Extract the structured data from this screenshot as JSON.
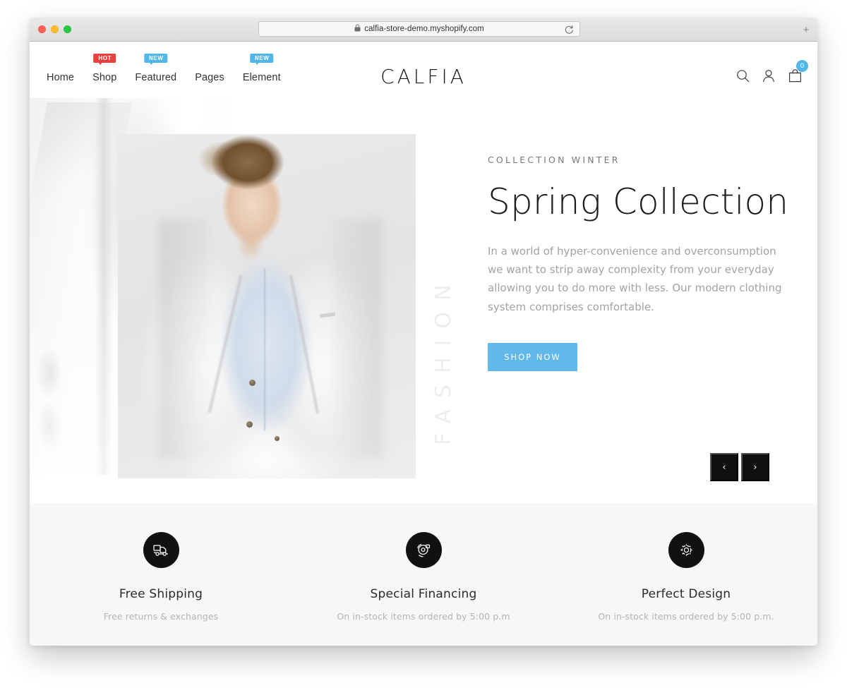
{
  "browser": {
    "url": "calfia-store-demo.myshopify.com",
    "lock_icon": "lock-icon",
    "reload_icon": "reload-icon",
    "new_tab_label": "+",
    "traffic_lights": [
      "close",
      "minimize",
      "zoom"
    ]
  },
  "header": {
    "logo": "CALFIA",
    "nav": [
      {
        "label": "Home",
        "badge": null,
        "badge_type": null
      },
      {
        "label": "Shop",
        "badge": "HOT",
        "badge_type": "hot"
      },
      {
        "label": "Featured",
        "badge": "NEW",
        "badge_type": "new"
      },
      {
        "label": "Pages",
        "badge": null,
        "badge_type": null
      },
      {
        "label": "Element",
        "badge": "NEW",
        "badge_type": "new"
      }
    ],
    "actions": {
      "search_icon": "search-icon",
      "account_icon": "user-icon",
      "cart_icon": "shopping-bag-icon",
      "cart_count": "0"
    }
  },
  "hero": {
    "vertical_word": "FASHION",
    "eyebrow": "COLLECTION WINTER",
    "title": "Spring Collection",
    "paragraph": "In a world of hyper-convenience and overconsumption we want to strip away complexity from your everyday allowing you to do more with less. Our modern clothing system comprises comfortable.",
    "cta_label": "SHOP NOW",
    "prev_label": "‹",
    "next_label": "›"
  },
  "features": [
    {
      "icon": "delivery-truck-icon",
      "title": "Free Shipping",
      "subtitle": "Free returns & exchanges"
    },
    {
      "icon": "financing-icon",
      "title": "Special Financing",
      "subtitle": "On in-stock items ordered by 5:00 p.m"
    },
    {
      "icon": "gear-design-icon",
      "title": "Perfect Design",
      "subtitle": "On in-stock items ordered by 5:00 p.m."
    }
  ],
  "colors": {
    "accent_blue": "#4fb7ea",
    "cta_blue": "#63b8ea",
    "hot_red": "#e8413f",
    "dark": "#111111",
    "features_bg": "#f7f7f7"
  }
}
